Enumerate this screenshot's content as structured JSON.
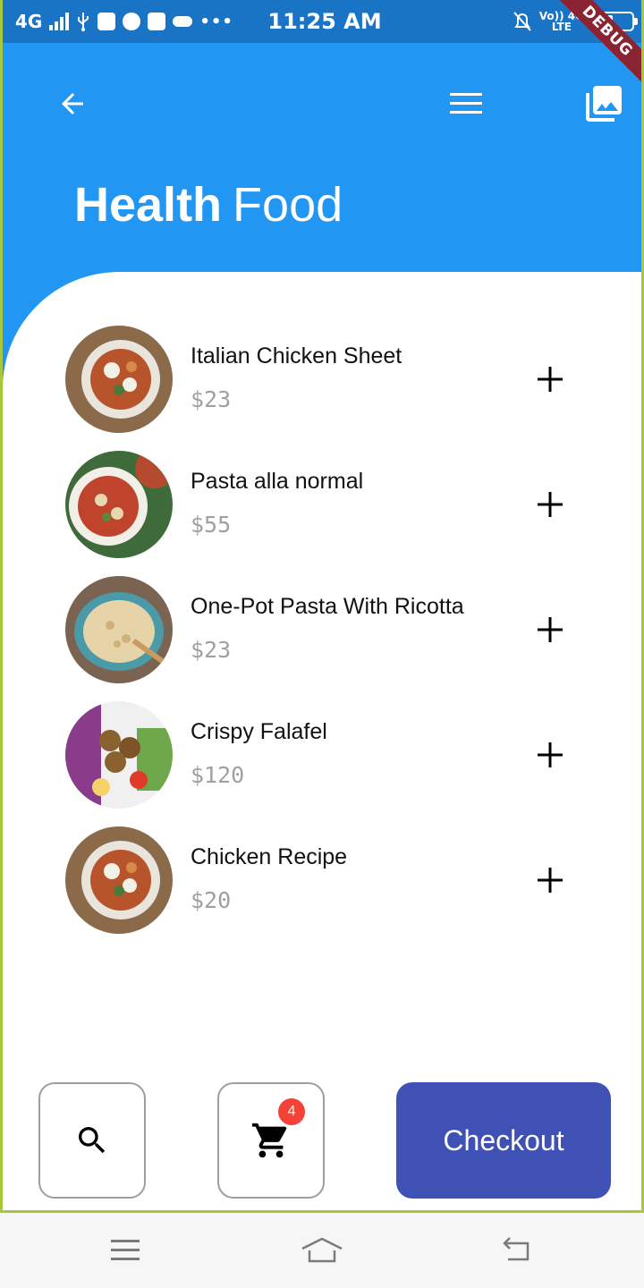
{
  "status_bar": {
    "network": "4G",
    "time": "11:25 AM",
    "right_network_top": "Vo)) 4G",
    "right_network_bottom": "LTE",
    "debug_label": "DEBUG"
  },
  "header": {
    "back_icon": "arrow-left-icon",
    "menu_icon": "hamburger-menu-icon",
    "gallery_icon": "photo-library-icon",
    "title_bold": "Health",
    "title_light": "Food",
    "background_color": "#2196f3"
  },
  "items": [
    {
      "name": "Italian Chicken Sheet",
      "price": "$23",
      "image": "italian-chicken-dish"
    },
    {
      "name": "Pasta alla normal",
      "price": "$55",
      "image": "pasta-dish"
    },
    {
      "name": "One-Pot Pasta With Ricotta",
      "price": "$23",
      "image": "ricotta-pasta-pot"
    },
    {
      "name": "Crispy Falafel",
      "price": "$120",
      "image": "falafel-salad"
    },
    {
      "name": "Chicken Recipe",
      "price": "$20",
      "image": "chicken-dish"
    }
  ],
  "actions": {
    "search_icon": "search-icon",
    "cart_icon": "shopping-cart-icon",
    "cart_count": "4",
    "checkout_label": "Checkout",
    "checkout_color": "#3f51b5",
    "badge_color": "#f44336"
  },
  "navbar": {
    "menu_icon": "menu-icon",
    "home_icon": "home-icon",
    "back_icon": "back-icon"
  }
}
